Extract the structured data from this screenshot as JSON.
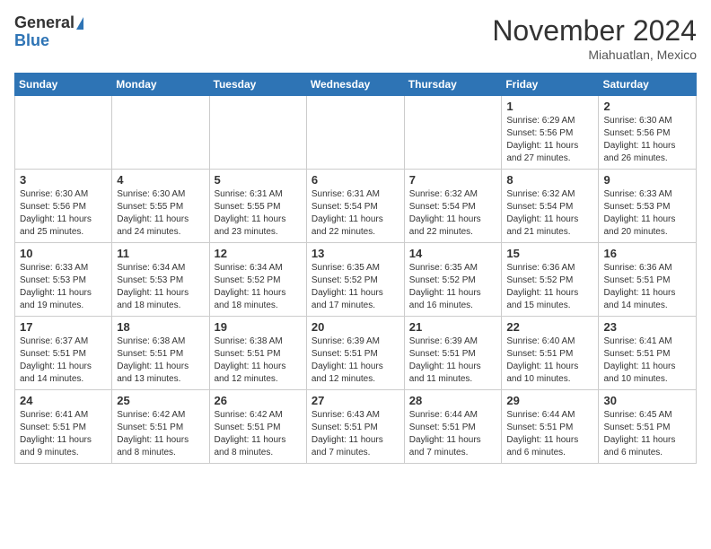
{
  "header": {
    "logo_general": "General",
    "logo_blue": "Blue",
    "month_title": "November 2024",
    "location": "Miahuatlan, Mexico"
  },
  "days_of_week": [
    "Sunday",
    "Monday",
    "Tuesday",
    "Wednesday",
    "Thursday",
    "Friday",
    "Saturday"
  ],
  "weeks": [
    [
      {
        "day": "",
        "info": ""
      },
      {
        "day": "",
        "info": ""
      },
      {
        "day": "",
        "info": ""
      },
      {
        "day": "",
        "info": ""
      },
      {
        "day": "",
        "info": ""
      },
      {
        "day": "1",
        "info": "Sunrise: 6:29 AM\nSunset: 5:56 PM\nDaylight: 11 hours and 27 minutes."
      },
      {
        "day": "2",
        "info": "Sunrise: 6:30 AM\nSunset: 5:56 PM\nDaylight: 11 hours and 26 minutes."
      }
    ],
    [
      {
        "day": "3",
        "info": "Sunrise: 6:30 AM\nSunset: 5:56 PM\nDaylight: 11 hours and 25 minutes."
      },
      {
        "day": "4",
        "info": "Sunrise: 6:30 AM\nSunset: 5:55 PM\nDaylight: 11 hours and 24 minutes."
      },
      {
        "day": "5",
        "info": "Sunrise: 6:31 AM\nSunset: 5:55 PM\nDaylight: 11 hours and 23 minutes."
      },
      {
        "day": "6",
        "info": "Sunrise: 6:31 AM\nSunset: 5:54 PM\nDaylight: 11 hours and 22 minutes."
      },
      {
        "day": "7",
        "info": "Sunrise: 6:32 AM\nSunset: 5:54 PM\nDaylight: 11 hours and 22 minutes."
      },
      {
        "day": "8",
        "info": "Sunrise: 6:32 AM\nSunset: 5:54 PM\nDaylight: 11 hours and 21 minutes."
      },
      {
        "day": "9",
        "info": "Sunrise: 6:33 AM\nSunset: 5:53 PM\nDaylight: 11 hours and 20 minutes."
      }
    ],
    [
      {
        "day": "10",
        "info": "Sunrise: 6:33 AM\nSunset: 5:53 PM\nDaylight: 11 hours and 19 minutes."
      },
      {
        "day": "11",
        "info": "Sunrise: 6:34 AM\nSunset: 5:53 PM\nDaylight: 11 hours and 18 minutes."
      },
      {
        "day": "12",
        "info": "Sunrise: 6:34 AM\nSunset: 5:52 PM\nDaylight: 11 hours and 18 minutes."
      },
      {
        "day": "13",
        "info": "Sunrise: 6:35 AM\nSunset: 5:52 PM\nDaylight: 11 hours and 17 minutes."
      },
      {
        "day": "14",
        "info": "Sunrise: 6:35 AM\nSunset: 5:52 PM\nDaylight: 11 hours and 16 minutes."
      },
      {
        "day": "15",
        "info": "Sunrise: 6:36 AM\nSunset: 5:52 PM\nDaylight: 11 hours and 15 minutes."
      },
      {
        "day": "16",
        "info": "Sunrise: 6:36 AM\nSunset: 5:51 PM\nDaylight: 11 hours and 14 minutes."
      }
    ],
    [
      {
        "day": "17",
        "info": "Sunrise: 6:37 AM\nSunset: 5:51 PM\nDaylight: 11 hours and 14 minutes."
      },
      {
        "day": "18",
        "info": "Sunrise: 6:38 AM\nSunset: 5:51 PM\nDaylight: 11 hours and 13 minutes."
      },
      {
        "day": "19",
        "info": "Sunrise: 6:38 AM\nSunset: 5:51 PM\nDaylight: 11 hours and 12 minutes."
      },
      {
        "day": "20",
        "info": "Sunrise: 6:39 AM\nSunset: 5:51 PM\nDaylight: 11 hours and 12 minutes."
      },
      {
        "day": "21",
        "info": "Sunrise: 6:39 AM\nSunset: 5:51 PM\nDaylight: 11 hours and 11 minutes."
      },
      {
        "day": "22",
        "info": "Sunrise: 6:40 AM\nSunset: 5:51 PM\nDaylight: 11 hours and 10 minutes."
      },
      {
        "day": "23",
        "info": "Sunrise: 6:41 AM\nSunset: 5:51 PM\nDaylight: 11 hours and 10 minutes."
      }
    ],
    [
      {
        "day": "24",
        "info": "Sunrise: 6:41 AM\nSunset: 5:51 PM\nDaylight: 11 hours and 9 minutes."
      },
      {
        "day": "25",
        "info": "Sunrise: 6:42 AM\nSunset: 5:51 PM\nDaylight: 11 hours and 8 minutes."
      },
      {
        "day": "26",
        "info": "Sunrise: 6:42 AM\nSunset: 5:51 PM\nDaylight: 11 hours and 8 minutes."
      },
      {
        "day": "27",
        "info": "Sunrise: 6:43 AM\nSunset: 5:51 PM\nDaylight: 11 hours and 7 minutes."
      },
      {
        "day": "28",
        "info": "Sunrise: 6:44 AM\nSunset: 5:51 PM\nDaylight: 11 hours and 7 minutes."
      },
      {
        "day": "29",
        "info": "Sunrise: 6:44 AM\nSunset: 5:51 PM\nDaylight: 11 hours and 6 minutes."
      },
      {
        "day": "30",
        "info": "Sunrise: 6:45 AM\nSunset: 5:51 PM\nDaylight: 11 hours and 6 minutes."
      }
    ]
  ]
}
